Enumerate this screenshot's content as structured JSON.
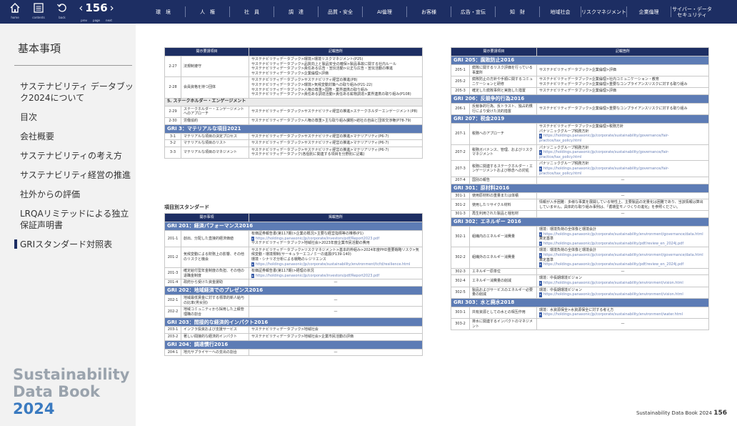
{
  "nav": {
    "home": "home",
    "contents": "contents",
    "back": "back",
    "prev": "prev",
    "page": "page",
    "next": "next",
    "page_number": "156"
  },
  "tabs": [
    "環　境",
    "人　権",
    "社　員",
    "調　達",
    "品質・安全",
    "AI倫理",
    "お客様",
    "広告・宣伝",
    "知　財",
    "地域社会",
    "リスクマネジメント",
    "企業倫理",
    "サイバー・データ セキュリティ"
  ],
  "sidebar": {
    "title": "基本事項",
    "items": [
      "サステナビリティ データブック2024について",
      "目次",
      "会社概要",
      "サステナビリティの考え方",
      "サステナビリティ経営の推進",
      "社外からの評価",
      "LRQAリミテッドによる独立保証声明書",
      "GRIスタンダード対照表"
    ],
    "brand_1": "Sustainability",
    "brand_2": "Data Book",
    "brand_3": "2024"
  },
  "colors": {
    "navy": "#1d2e63",
    "section": "#5d7cb5"
  },
  "table1": {
    "header": [
      "開示要請項目",
      "記載箇所"
    ],
    "rows": [
      {
        "no": "2-27",
        "item": "法規制遵守",
        "lines": [
          "サステナビリティデータブック>環境>環境リスクマネジメント(P25)",
          "サステナビリティデータブック>品質向上と製品安全の確保>製品事故に関する社内ルール",
          "サステナビリティデータブック>責任ある広告・宣伝活動>公正な広告・宣伝活動の推進",
          "サステナビリティデータブック>企業倫理>評価"
        ]
      },
      {
        "no": "2-28",
        "item": "会員資格を持つ団体",
        "lines": [
          "サステナビリティデータブック>サステナビリティ経営の推進(P8)",
          "サステナビリティデータブック>環境>気候変動対策への取り組み(P21-22)",
          "サステナビリティデータブック>人権の尊重>国際・業界連携の取り組み",
          "サステナビリティデータブック>責任ある調達活動>責任ある鉱物調達>業界連携の取り組み(P108)"
        ]
      }
    ],
    "section": "5. ステークホルダー・エンゲージメント",
    "rows2": [
      {
        "no": "2-29",
        "item": "ステークホルダー・エンゲージメントへのアプローチ",
        "lines": [
          "サステナビリティデータブック>サステナビリティ経営の推進>ステークホルダーエンゲージメント(P8)"
        ]
      },
      {
        "no": "2-30",
        "item": "労働協約",
        "lines": [
          "サステナビリティデータブック>人権の尊重>主な取り組み課題>結社の自由と団体交渉権(P78-79)"
        ]
      }
    ],
    "gri3": "GRI 3：マテリアルな項目2021",
    "rows3": [
      {
        "no": "3-1",
        "item": "マテリアルな項目の決定プロセス",
        "lines": [
          "サステナビリティデータブック>サステナビリティ経営の推進>マテリアリティ(P6-7)"
        ]
      },
      {
        "no": "3-2",
        "item": "マテリアルな項目のリスト",
        "lines": [
          "サステナビリティデータブック>サステナビリティ経営の推進>マテリアリティ(P6-7)"
        ]
      },
      {
        "no": "3-3",
        "item": "マテリアルな項目のマネジメント",
        "lines": [
          "サステナビリティデータブック>サステナビリティ経営の推進>マテリアリティ(P6-7)",
          "サステナビリティデータブック(各個別に関連する項目を分野別に記載)"
        ]
      }
    ]
  },
  "subhead": "項目別スタンダード",
  "table2": {
    "header": [
      "開示事項",
      "掲載箇所"
    ],
    "g201": "GRI 201：経済パフォーマンス2016",
    "r201": [
      {
        "no": "201-1",
        "item": "創出、分配した直接的経済価値",
        "lines": [
          "有価証券報告書(第117期)>企業の概況>主要な経営指標等の推移(P1)",
          "https://holdings.panasonic/jp/corporate/investors/pdf/Report2023.pdf",
          "サステナビリティデータブック>地域社会>2023年度企業市民活動の費用"
        ]
      },
      {
        "no": "201-2",
        "item": "気候変動による財務上の影響、その他のリスクと機会",
        "lines": [
          "サステナビリティデータブック>リスクマネジメント>基本的枠組み>2024年度PHD重要戦略リスク>気候変動・環境規制(サーキュラーエコノミーの進展(P139-140)",
          "環境・シナリオ分析による戦略のレジリエンス",
          "https://holdings.panasonic/jp/corporate/sustainability/environment/tcfd/resilience.html"
        ]
      },
      {
        "no": "201-3",
        "item": "確定給付型年金制度の負担、その他の退職金制度",
        "lines": [
          "有価証券報告書(第117期)>経理の状況",
          "https://holdings.panasonic/jp/corporate/investors/pdf/Report2023.pdf"
        ]
      },
      {
        "no": "201-4",
        "item": "政府から受けた資金援助",
        "dash": "—"
      }
    ],
    "g202": "GRI 202：地域経済でのプレゼンス2016",
    "r202": [
      {
        "no": "202-1",
        "item": "地域最低賃金に対する標準的新人給与の比率(男女別)",
        "dash": "—"
      },
      {
        "no": "202-2",
        "item": "地域コミュニティから採用した上級管理職の割合",
        "dash": "—"
      }
    ],
    "g203": "GRI 203：間接的な経済的インパクト2016",
    "r203": [
      {
        "no": "203-1",
        "item": "インフラ投資および支援サービス",
        "lines": [
          "サステナビリティデータブック>地域社会"
        ]
      },
      {
        "no": "203-2",
        "item": "著しい間接的な経済的インパクト",
        "lines": [
          "サステナビリティデータブック>地域社会>企業市民活動の評価"
        ]
      }
    ],
    "g204": "GRI 204：調達慣行2016",
    "r204": [
      {
        "no": "204-1",
        "item": "地元サプライヤーへの支出の割合",
        "dash": "—"
      }
    ]
  },
  "table3": {
    "header": [
      "開示要請項目",
      "記載箇所"
    ],
    "g205": "GRI 205：腐敗防止2016",
    "r205": [
      {
        "no": "205-1",
        "item": "腐敗に関するリスク評価を行っている事業所",
        "lines": [
          "サステナビリティデータブック>企業倫理>評価"
        ]
      },
      {
        "no": "205-2",
        "item": "腐敗防止の方針や手順に関するコミュニケーションと研修",
        "lines": [
          "サステナビリティデータブック>企業倫理>社内コミュニケーション・教育",
          "サステナビリティデータブック>企業倫理>重要なコンプライアンスリスクに対する取り組み"
        ]
      },
      {
        "no": "205-3",
        "item": "確定した腐敗事例と実施した措置",
        "lines": [
          "サステナビリティデータブック>企業倫理>評価"
        ]
      }
    ],
    "g206": "GRI 206：反競争的行為2016",
    "r206": [
      {
        "no": "206-1",
        "item": "反競争的行為、反トラスト、独占的慣行により受けた法的措置",
        "lines": [
          "サステナビリティデータブック>企業倫理>重要なコンプライアンスリスクに対する取り組み"
        ]
      }
    ],
    "g207": "GRI 207：税金2019",
    "r207": [
      {
        "no": "207-1",
        "item": "税務へのアプローチ",
        "lines": [
          "サステナビリティデータブック>企業倫理>税務方針",
          "パナソニックグループ税務方針",
          "https://holdings.panasonic/jp/corporate/sustainability/governance/fair-practice/tax_policy.html"
        ]
      },
      {
        "no": "207-2",
        "item": "税務ガバナンス、管理、およびリスクマネジメント",
        "lines": [
          "パナソニックグループ税務方針",
          "https://holdings.panasonic/jp/corporate/sustainability/governance/fair-practice/tax_policy.html"
        ]
      },
      {
        "no": "207-3",
        "item": "税務に関連するステークホルダー・エンゲージメントおよび懸念への対処",
        "lines": [
          "パナソニックグループ税務方針",
          "https://holdings.panasonic/jp/corporate/sustainability/governance/fair-practice/tax_policy.html"
        ]
      },
      {
        "no": "207-4",
        "item": "国別の報告",
        "dash": "—"
      }
    ],
    "g301": "GRI 301：原材料2016",
    "r301": [
      {
        "no": "301-1",
        "item": "使用原材料の重量または体積",
        "dash": "—"
      },
      {
        "no": "301-2",
        "item": "使用したリサイクル材料",
        "lines": [
          "情報が入手困難：多様な事業を展開している特性上、主要製品の定量化は困難であり、当該情報は算出していません。具体的な取り組み事例は、「循環型モノづくりの進化」を参照ください。"
        ]
      },
      {
        "no": "301-3",
        "item": "再生利用された製品と梱包材",
        "dash": "—"
      }
    ],
    "g302": "GRI 302：エネルギー 2016",
    "r302": [
      {
        "no": "302-1",
        "item": "組織内のエネルギー消費量",
        "lines": [
          "環境：環境負荷の全体像と環境会計",
          "https://holdings.panasonic/jp/corporate/sustainability/environment/governance/data.html",
          "算定基準",
          "https://holdings.panasonic/jp/corporate/sustainability/pdf/review_en_2024j.pdf"
        ]
      },
      {
        "no": "302-2",
        "item": "組織外のエネルギー消費量",
        "lines": [
          "環境：環境負荷の全体像と環境会計",
          "https://holdings.panasonic/jp/corporate/sustainability/environment/governance/data.html",
          "算定基準",
          "https://holdings.panasonic/jp/corporate/sustainability/pdf/review_en_2024j.pdf"
        ]
      },
      {
        "no": "302-3",
        "item": "エネルギー原単位",
        "dash": "—"
      },
      {
        "no": "302-4",
        "item": "エネルギー消費量の削減",
        "lines": [
          "環境：中長期環境ビジョン",
          "https://holdings.panasonic/jp/corporate/sustainability/environment/vision.html"
        ]
      },
      {
        "no": "302-5",
        "item": "製品およびサービスのエネルギー必要量の削減",
        "lines": [
          "環境：中長期環境ビジョン",
          "https://holdings.panasonic/jp/corporate/sustainability/environment/vision.html"
        ]
      }
    ],
    "g303": "GRI 303：水と廃水2018",
    "r303": [
      {
        "no": "303-1",
        "item": "共有資源としての水との相互作用",
        "lines": [
          "環境：水資源保全>水資源保全に対する考え方",
          "https://holdings.panasonic/jp/corporate/sustainability/environment/water.html"
        ]
      },
      {
        "no": "303-2",
        "item": "排水に関連するインパクトのマネジメント",
        "dash": "—"
      }
    ]
  },
  "footer": {
    "label": "Sustainability Data Book 2024",
    "page": "156"
  }
}
